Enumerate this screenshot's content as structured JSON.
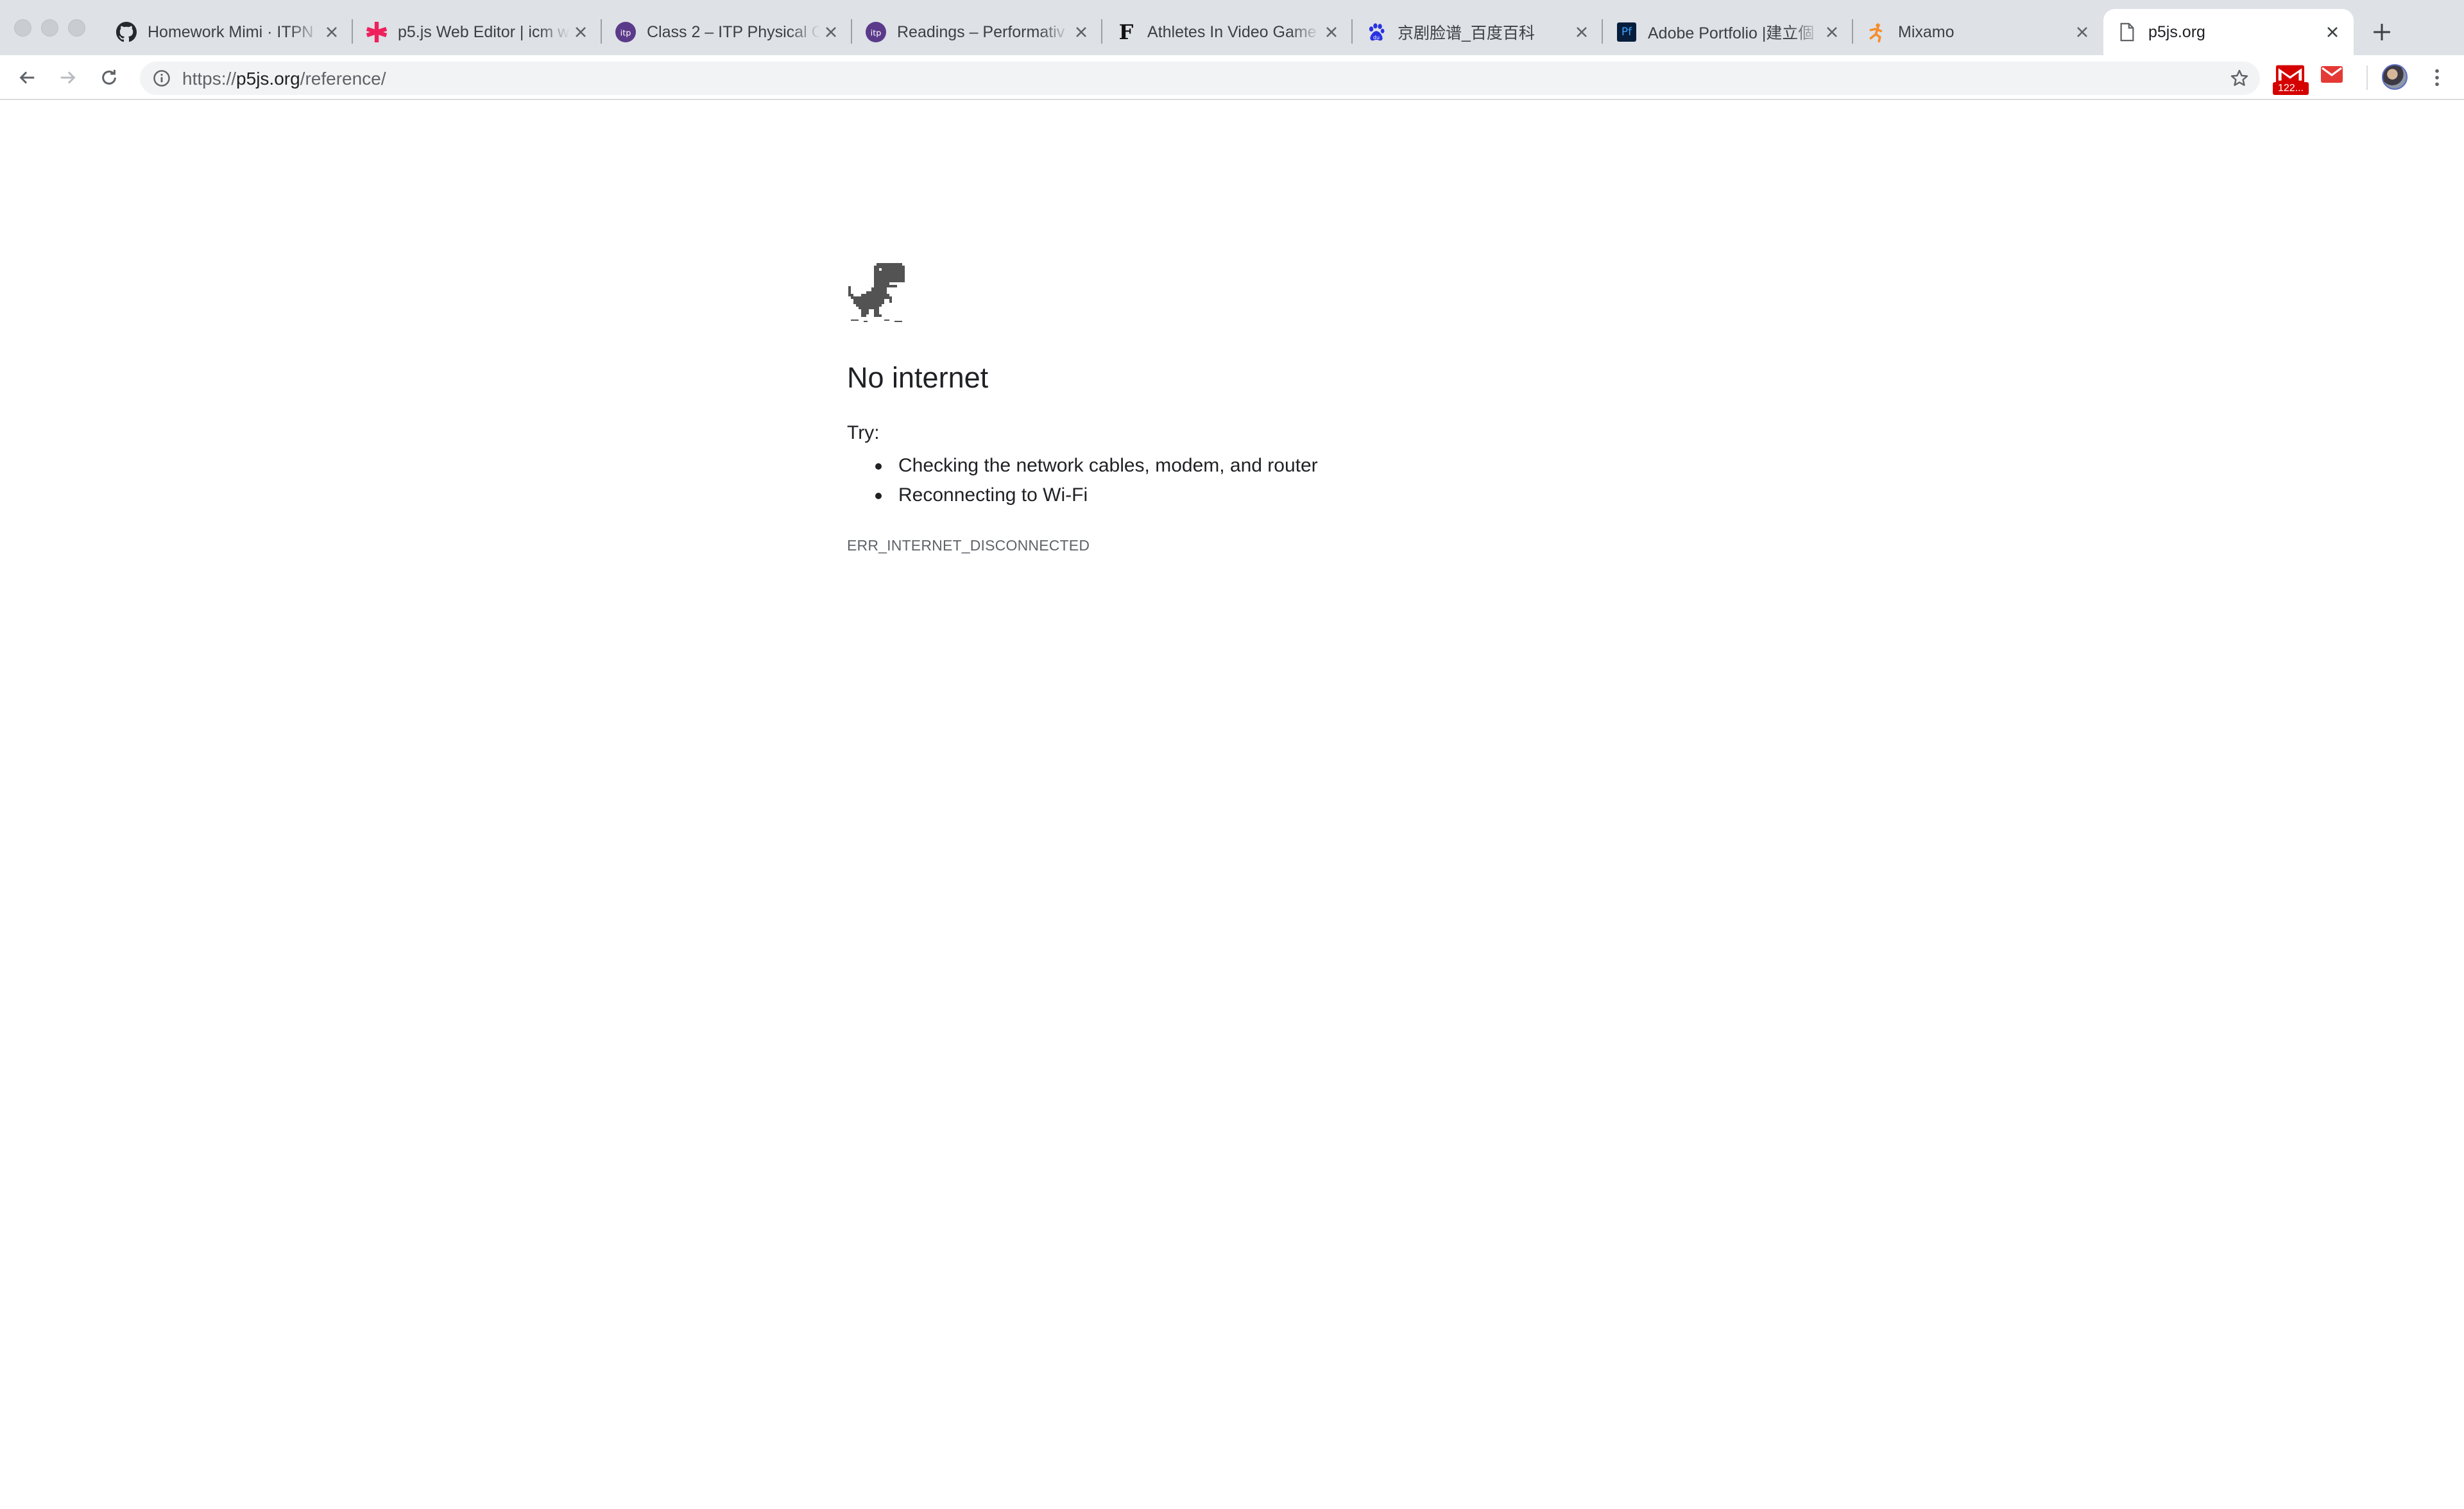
{
  "tabs": [
    {
      "title": "Homework Mimi · ITPN",
      "icon": "github-icon"
    },
    {
      "title": "p5.js Web Editor | icm w",
      "icon": "p5js-asterisk-icon"
    },
    {
      "title": "Class 2 – ITP Physical C",
      "icon": "itp-logo-icon"
    },
    {
      "title": "Readings – Performativ",
      "icon": "itp-logo-icon"
    },
    {
      "title": "Athletes In Video Game",
      "icon": "f-letter-icon",
      "icon_text": "F"
    },
    {
      "title": "京剧脸谱_百度百科",
      "icon": "baidu-paw-icon"
    },
    {
      "title": "Adobe Portfolio |建立個",
      "icon": "adobe-portfolio-icon",
      "icon_text": "Pf"
    },
    {
      "title": "Mixamo",
      "icon": "mixamo-icon"
    },
    {
      "title": "p5js.org",
      "icon": "page-icon",
      "active": true
    }
  ],
  "omnibox": {
    "scheme": "https://",
    "host": "p5js.org",
    "path": "/reference/"
  },
  "extensions": {
    "gmail_count": "122..."
  },
  "error_page": {
    "heading": "No internet",
    "try_label": "Try:",
    "suggestions": [
      "Checking the network cables, modem, and router",
      "Reconnecting to Wi-Fi"
    ],
    "error_code": "ERR_INTERNET_DISCONNECTED"
  },
  "colors": {
    "tabstrip_bg": "#dee1e6",
    "text_primary": "#202124",
    "text_secondary": "#5f6368",
    "itp_purple": "#5b3a8a",
    "p5_pink": "#ed225d",
    "gmail_red": "#d50000"
  }
}
